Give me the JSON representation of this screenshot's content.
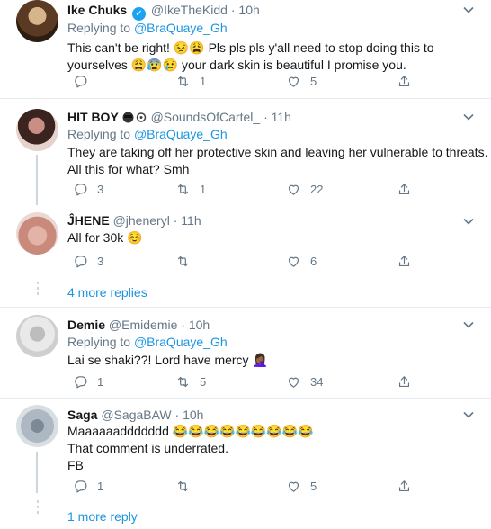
{
  "tweets": [
    {
      "name": "Ike Chuks",
      "handle": "@IkeTheKidd",
      "time": "10h",
      "replying_label": "Replying to",
      "replying_to": "@BraQuaye_Gh",
      "text_line1": "This can't be right! 😣😩 Pls pls pls y'all need to stop doing this to",
      "text_line2": "yourselves 😩😰😢 your dark skin is beautiful I promise you.",
      "replies": "",
      "retweets": "1",
      "likes": "5"
    },
    {
      "name": "HIT BOY",
      "handle": "@SoundsOfCartel_",
      "time": "11h",
      "replying_label": "Replying to",
      "replying_to": "@BraQuaye_Gh",
      "text_line1": "They are taking off her protective skin and leaving her vulnerable to threats.",
      "text_line2": "All this for what? Smh",
      "replies": "3",
      "retweets": "1",
      "likes": "22"
    },
    {
      "name": "ĴHENE",
      "handle": "@jheneryl",
      "time": "11h",
      "text_line1": "All for 30k ☺️",
      "replies": "3",
      "retweets": "",
      "likes": "6"
    },
    {
      "name": "Demie",
      "handle": "@Emidemie",
      "time": "10h",
      "replying_label": "Replying to",
      "replying_to": "@BraQuaye_Gh",
      "text_line1": "Lai se shaki??! Lord have mercy 🤦🏾‍♀️",
      "replies": "1",
      "retweets": "5",
      "likes": "34"
    },
    {
      "name": "Saga",
      "handle": "@SagaBAW",
      "time": "10h",
      "text_line1": "Maaaaaaddddddd 😂😂😂😂😂😂😂😂😂",
      "text_line2": "That comment is underrated.",
      "text_line3": "FB",
      "replies": "1",
      "retweets": "",
      "likes": "5"
    }
  ],
  "more_replies_1": "4 more replies",
  "more_replies_2": "1 more reply",
  "dot": "·",
  "colors": {
    "link": "#1b95e0",
    "muted": "#657786",
    "divider": "#e6ecf0",
    "verified": "#1da1f2"
  },
  "icons": [
    "reply-icon",
    "retweet-icon",
    "like-icon",
    "share-icon",
    "chevron-down-icon",
    "verified-badge-icon"
  ]
}
